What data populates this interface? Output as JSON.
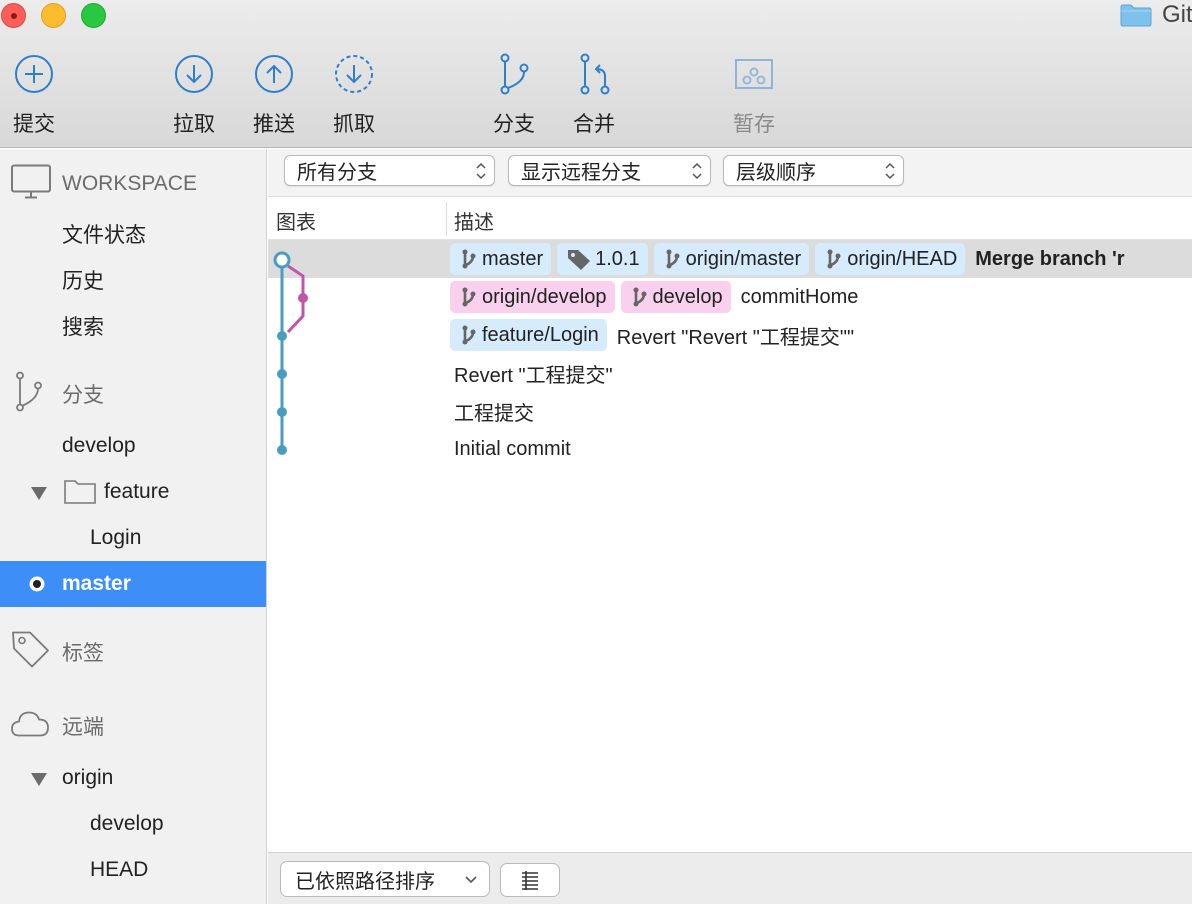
{
  "window": {
    "title": "Git",
    "buttons": [
      "close",
      "minimize",
      "zoom"
    ]
  },
  "toolbar": {
    "commit_label": "提交",
    "pull_label": "拉取",
    "push_label": "推送",
    "fetch_label": "抓取",
    "branch_label": "分支",
    "merge_label": "合并",
    "stash_label": "暂存"
  },
  "sidebar": {
    "workspace": {
      "title": "WORKSPACE",
      "items": [
        "文件状态",
        "历史",
        "搜索"
      ]
    },
    "branches": {
      "title": "分支",
      "develop": "develop",
      "feature_folder": "feature",
      "feature_login": "Login",
      "master": "master"
    },
    "tags": {
      "title": "标签"
    },
    "remotes": {
      "title": "远端",
      "origin": "origin",
      "origin_develop": "develop",
      "origin_head": "HEAD"
    }
  },
  "filters": {
    "branches": "所有分支",
    "remote": "显示远程分支",
    "order": "层级顺序"
  },
  "columns": {
    "graph": "图表",
    "description": "描述"
  },
  "commits": [
    {
      "tags": [
        {
          "label": "master",
          "kind": "branch",
          "color": "blue"
        },
        {
          "label": "1.0.1",
          "kind": "tag",
          "color": "blue"
        },
        {
          "label": "origin/master",
          "kind": "branch",
          "color": "blue"
        },
        {
          "label": "origin/HEAD",
          "kind": "branch",
          "color": "blue"
        }
      ],
      "message": "Merge branch 'r",
      "bold": true
    },
    {
      "tags": [
        {
          "label": "origin/develop",
          "kind": "branch",
          "color": "pink"
        },
        {
          "label": "develop",
          "kind": "branch",
          "color": "pink"
        }
      ],
      "message": "commitHome"
    },
    {
      "tags": [
        {
          "label": "feature/Login",
          "kind": "branch",
          "color": "blue"
        }
      ],
      "message": "Revert \"Revert \"工程提交\"\""
    },
    {
      "tags": [],
      "message": "Revert \"工程提交\""
    },
    {
      "tags": [],
      "message": "工程提交"
    },
    {
      "tags": [],
      "message": "Initial commit"
    }
  ],
  "footer": {
    "sort": "已依照路径排序"
  },
  "colors": {
    "accent": "#3d8ff7",
    "graph_main": "#4a9ebd",
    "graph_branch": "#c056a8",
    "tag_blue": "#d6ebfb",
    "tag_pink": "#f9d1ef"
  }
}
